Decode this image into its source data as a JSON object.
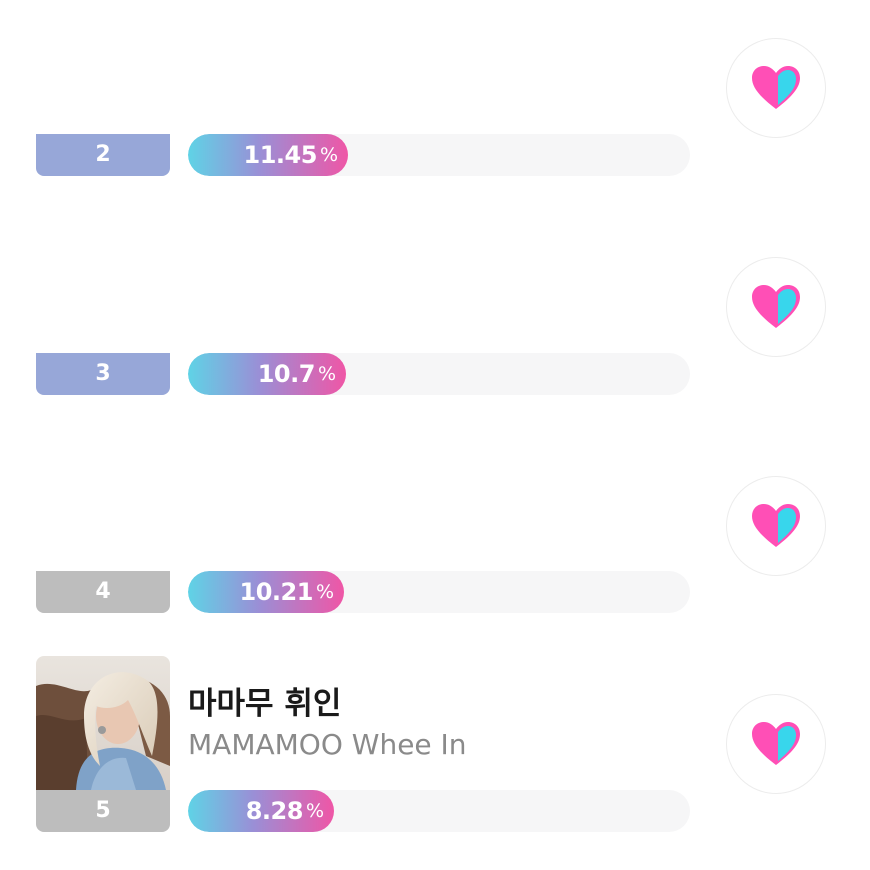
{
  "colors": {
    "badge_top": "#97a7d8",
    "badge_normal": "#bdbdbd",
    "bar_gradient_start": "#5fd3e6",
    "bar_gradient_end": "#ef56a6",
    "heart_pink": "#ff4fb6",
    "heart_cyan": "#38d6ec"
  },
  "rankings": [
    {
      "rank": "2",
      "percent": "11.45",
      "percent_sign": "%",
      "vote_icon": "heart-icon"
    },
    {
      "rank": "3",
      "percent": "10.7",
      "percent_sign": "%",
      "vote_icon": "heart-icon"
    },
    {
      "rank": "4",
      "percent": "10.21",
      "percent_sign": "%",
      "vote_icon": "heart-icon"
    },
    {
      "rank": "5",
      "percent": "8.28",
      "percent_sign": "%",
      "vote_icon": "heart-icon",
      "artist_name_ko": "마마무 휘인",
      "artist_name_en": "MAMAMOO Whee In"
    }
  ]
}
